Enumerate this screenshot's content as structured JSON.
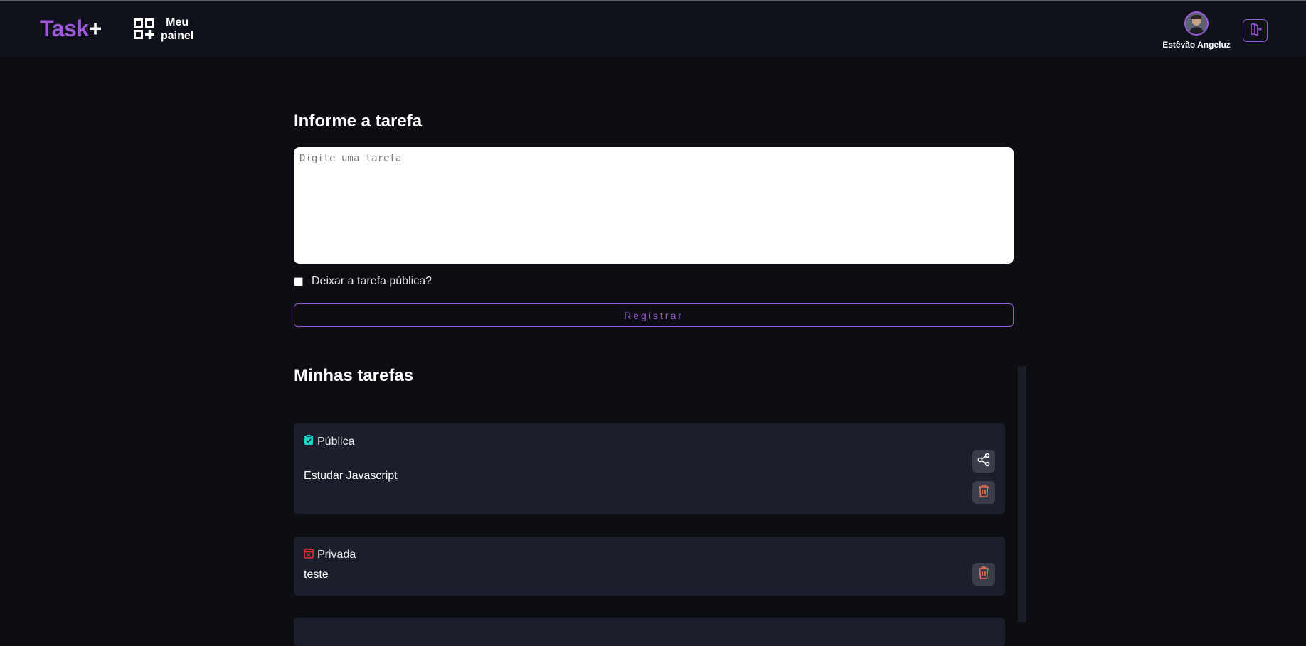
{
  "header": {
    "logo_text": "Task",
    "logo_plus": "+",
    "panel_line1": "Meu",
    "panel_line2": "painel",
    "user_name": "Estêvão Angeluz",
    "accent_color": "#9b59d6"
  },
  "form": {
    "title": "Informe a tarefa",
    "textarea_placeholder": "Digite uma tarefa",
    "public_checkbox_label": "Deixar a tarefa pública?",
    "public_checked": false,
    "register_label": "Registrar"
  },
  "tasks_section": {
    "title": "Minhas tarefas",
    "tasks": [
      {
        "visibility": "Pública",
        "visibility_icon": "clipboard-check-icon",
        "icon_color": "#1ed1c4",
        "text": "Estudar Javascript",
        "actions": [
          "share-icon",
          "trash-icon"
        ]
      },
      {
        "visibility": "Privada",
        "visibility_icon": "calendar-x-icon",
        "icon_color": "#e0323c",
        "text": "teste",
        "actions": [
          "trash-icon"
        ]
      }
    ]
  }
}
